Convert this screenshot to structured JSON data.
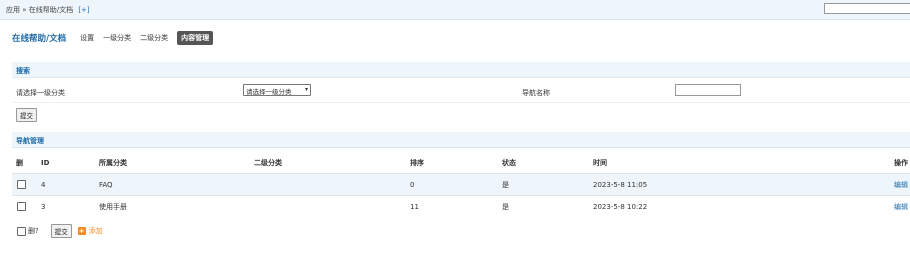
{
  "topbar": {
    "breadcrumb": "应用 » 在线帮助/文档",
    "add_link": "[+]",
    "search_value": ""
  },
  "nav": {
    "brand": "在线帮助/文档",
    "links": [
      "设置",
      "一级分类",
      "二级分类",
      "内容管理"
    ],
    "active_index": 3
  },
  "search_section": {
    "title": "搜索",
    "category_label": "请选择一级分类",
    "category_select": "请选择一级分类",
    "name_label": "导航名称",
    "name_value": "",
    "submit": "提交"
  },
  "manage_section": {
    "title": "导航管理",
    "columns": [
      "删",
      "ID",
      "所属分类",
      "二级分类",
      "排序",
      "状态",
      "时间",
      "操作"
    ],
    "rows": [
      {
        "id": "4",
        "category": "FAQ",
        "subcategory": "",
        "order": "0",
        "status": "是",
        "time": "2023-5-8 11:05",
        "action": "编辑"
      },
      {
        "id": "3",
        "category": "使用手册",
        "subcategory": "",
        "order": "11",
        "status": "是",
        "time": "2023-5-8 10:22",
        "action": "编辑"
      }
    ]
  },
  "bottom": {
    "delete_label": "删?",
    "submit": "提交",
    "add_label": "添加"
  },
  "colors": {
    "accent": "#1e6aa8",
    "header_bg": "#eef6fc",
    "add_orange": "#f08a24"
  }
}
